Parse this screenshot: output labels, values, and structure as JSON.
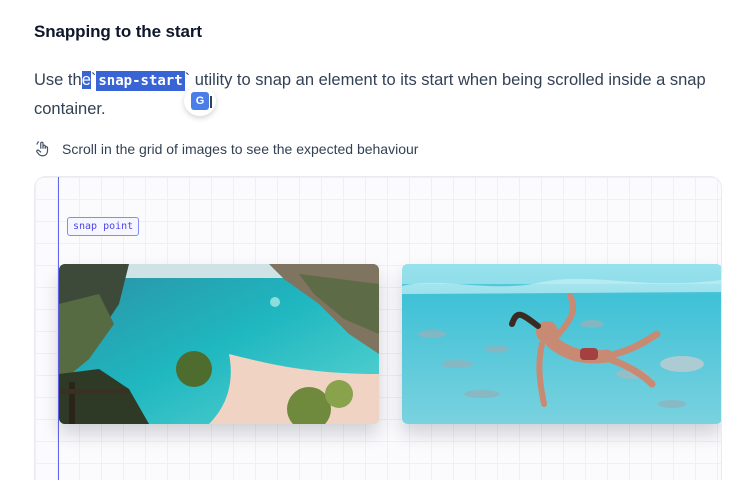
{
  "section": {
    "title": "Snapping to the start"
  },
  "paragraph": {
    "before": "Use th",
    "selected_char": "e",
    "backtick_open": "`",
    "code": "snap-start",
    "backtick_close": "`",
    "after": " utility to snap an element to its start when being scrolled inside a snap container."
  },
  "translate_popup": {
    "icon": "google-translate-icon",
    "glyph": "G"
  },
  "hint": {
    "icon": "hand-scroll-icon",
    "text": "Scroll in the grid of images to see the expected behaviour"
  },
  "demo": {
    "snap_label": "snap point",
    "accent_color": "#6366f1",
    "cards": [
      {
        "name": "beach-cliff-image"
      },
      {
        "name": "underwater-swimmer-image"
      }
    ]
  },
  "colors": {
    "selection": "#3864d6",
    "text": "#334155",
    "heading": "#0f172a"
  }
}
